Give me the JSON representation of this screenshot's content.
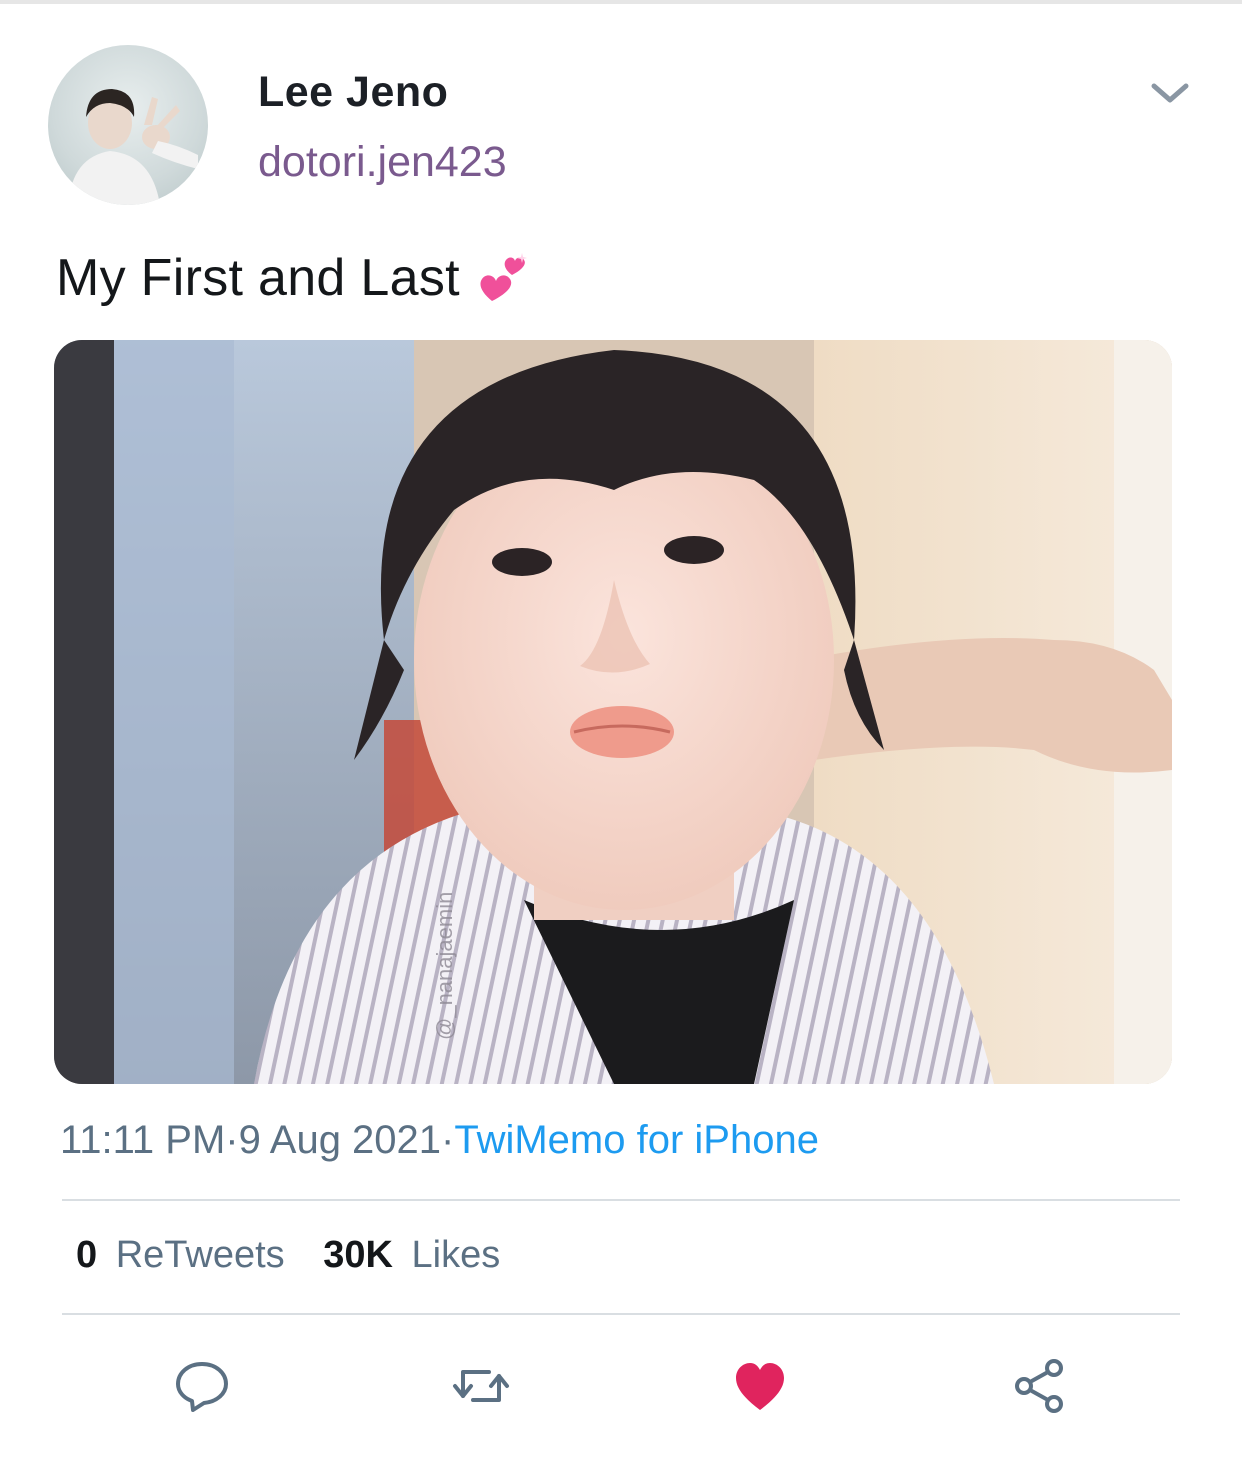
{
  "user": {
    "display_name": "Lee Jeno",
    "handle": "dotori.jen423",
    "avatar_icon": "profile-photo"
  },
  "tweet": {
    "text": "My First and Last",
    "emoji": "💕",
    "photo_watermark": "@_nanajaemin",
    "time": "11:11 PM",
    "separator": "·",
    "date": "9 Aug 2021",
    "source": "TwiMemo for iPhone"
  },
  "stats": {
    "retweets_count": "0",
    "retweets_label": "ReTweets",
    "likes_count": "30K",
    "likes_label": "Likes"
  },
  "actions": [
    "reply-icon",
    "retweet-icon",
    "like-icon",
    "share-icon"
  ],
  "colors": {
    "handle": "#7a5a8e",
    "link": "#1d9bf0",
    "meta": "#5b7083",
    "like": "#e0245e"
  }
}
